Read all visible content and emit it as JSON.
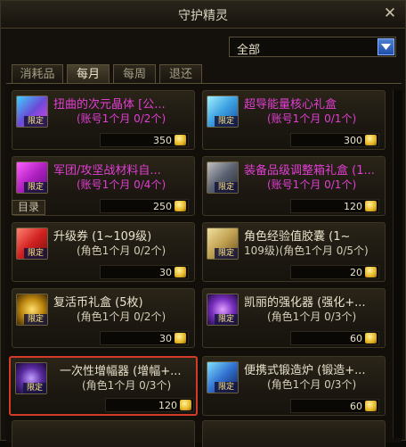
{
  "window": {
    "title": "守护精灵"
  },
  "filter": {
    "selected": "全部"
  },
  "tabs": [
    "消耗品",
    "每月",
    "每周",
    "退还"
  ],
  "active_tab": "每月",
  "catalog_label": "目录",
  "items": [
    {
      "name": "扭曲的次元晶体 [公...",
      "limit": "(账号1个月 0/2个)",
      "price": "350",
      "badge": "限定",
      "color": "magenta",
      "icon": "dimension-crystal-icon"
    },
    {
      "name": "超导能量核心礼盒",
      "limit": "(账号1个月 0/1个)",
      "price": "300",
      "badge": "限定",
      "color": "magenta",
      "icon": "energy-core-box-icon"
    },
    {
      "name": "军团/攻坚战材料自...",
      "limit": "(账号1个月 0/4个)",
      "price": "250",
      "badge": "限定",
      "color": "magenta",
      "icon": "raid-material-icon"
    },
    {
      "name": "装备品级调整箱礼盒 (1...",
      "limit": "(账号1个月 0/1个)",
      "price": "120",
      "badge": "限定",
      "color": "magenta",
      "icon": "grade-adjust-box-icon"
    },
    {
      "name": "升级券 (1~109级)",
      "limit": "(角色1个月 0/2个)",
      "price": "30",
      "badge": "限定",
      "color": "white",
      "icon": "level-up-ticket-icon"
    },
    {
      "name": "角色经验值胶囊 (1~109级)(角色1个月 0/5个)",
      "limit": "(角色1个月 0/5个)",
      "price": "20",
      "badge": "限定",
      "color": "white",
      "icon": "exp-capsule-icon"
    },
    {
      "name": "复活币礼盒 (5枚)",
      "limit": "(角色1个月 0/2个)",
      "price": "30",
      "badge": "限定",
      "color": "white",
      "icon": "revive-coin-box-icon"
    },
    {
      "name": "凯丽的强化器 (强化+...",
      "limit": "(角色1个月 0/3个)",
      "price": "60",
      "badge": "限定",
      "color": "white",
      "icon": "kiri-enhancer-icon"
    },
    {
      "name": "一次性增幅器 (增幅+...",
      "limit": "(角色1个月 0/3个)",
      "price": "120",
      "badge": "限定",
      "color": "white",
      "icon": "amplifier-icon"
    },
    {
      "name": "便携式锻造炉 (锻造+...",
      "limit": "(角色1个月 0/3个)",
      "price": "60",
      "badge": "限定",
      "color": "white",
      "icon": "portable-forge-icon"
    }
  ]
}
